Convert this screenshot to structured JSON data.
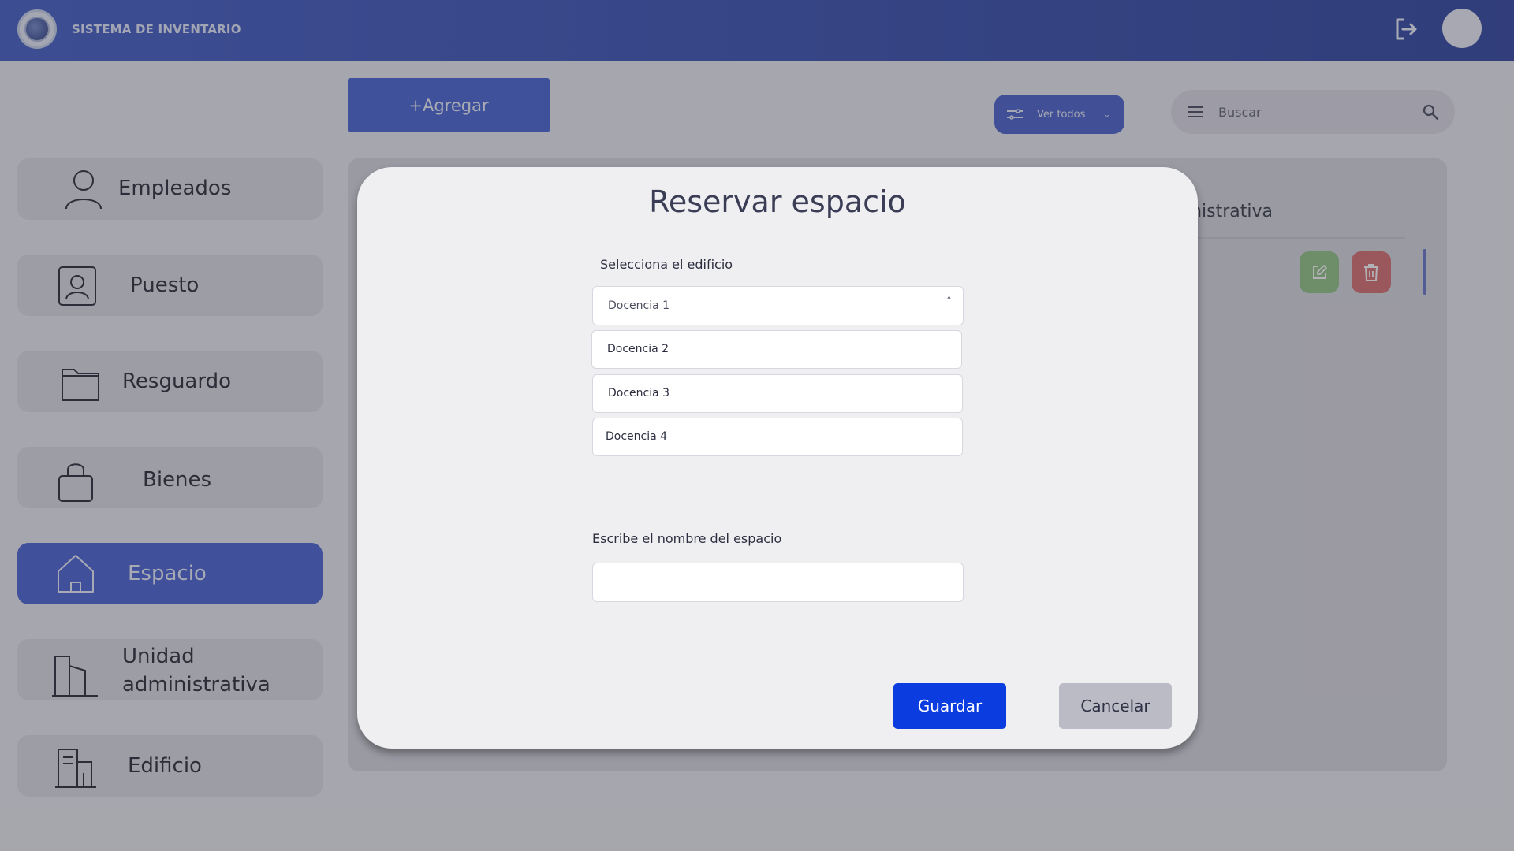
{
  "header": {
    "app_title": "SISTEMA DE INVENTARIO"
  },
  "toolbar": {
    "add_label": "+Agregar",
    "filter_label": "Ver todos",
    "search_placeholder": "Buscar"
  },
  "sidebar": {
    "items": [
      {
        "label": "Empleados",
        "icon": "user-icon",
        "active": false
      },
      {
        "label": "Puesto",
        "icon": "id-badge-icon",
        "active": false
      },
      {
        "label": "Resguardo",
        "icon": "folder-icon",
        "active": false
      },
      {
        "label": "Bienes",
        "icon": "bag-icon",
        "active": false
      },
      {
        "label": "Espacio",
        "icon": "house-icon",
        "active": true
      },
      {
        "label": "Unidad administrativa",
        "label_line1": "Unidad",
        "label_line2": "administrativa",
        "icon": "building-icon",
        "active": false
      },
      {
        "label": "Edificio",
        "icon": "office-building-icon",
        "active": false
      }
    ]
  },
  "panel": {
    "column_title_partial": "inistrativa"
  },
  "modal": {
    "title": "Reservar espacio",
    "building_label": "Selecciona el edificio",
    "building_selected": "Docencia 1",
    "building_options": [
      "Docencia 2",
      "Docencia 3",
      "Docencia 4"
    ],
    "space_label": "Escribe el nombre del espacio",
    "space_value": "",
    "save_label": "Guardar",
    "cancel_label": "Cancelar"
  },
  "colors": {
    "accent": "#3d59cf",
    "primary_button": "#0b3cdf",
    "edit": "#8cc27a",
    "delete": "#d86565"
  }
}
